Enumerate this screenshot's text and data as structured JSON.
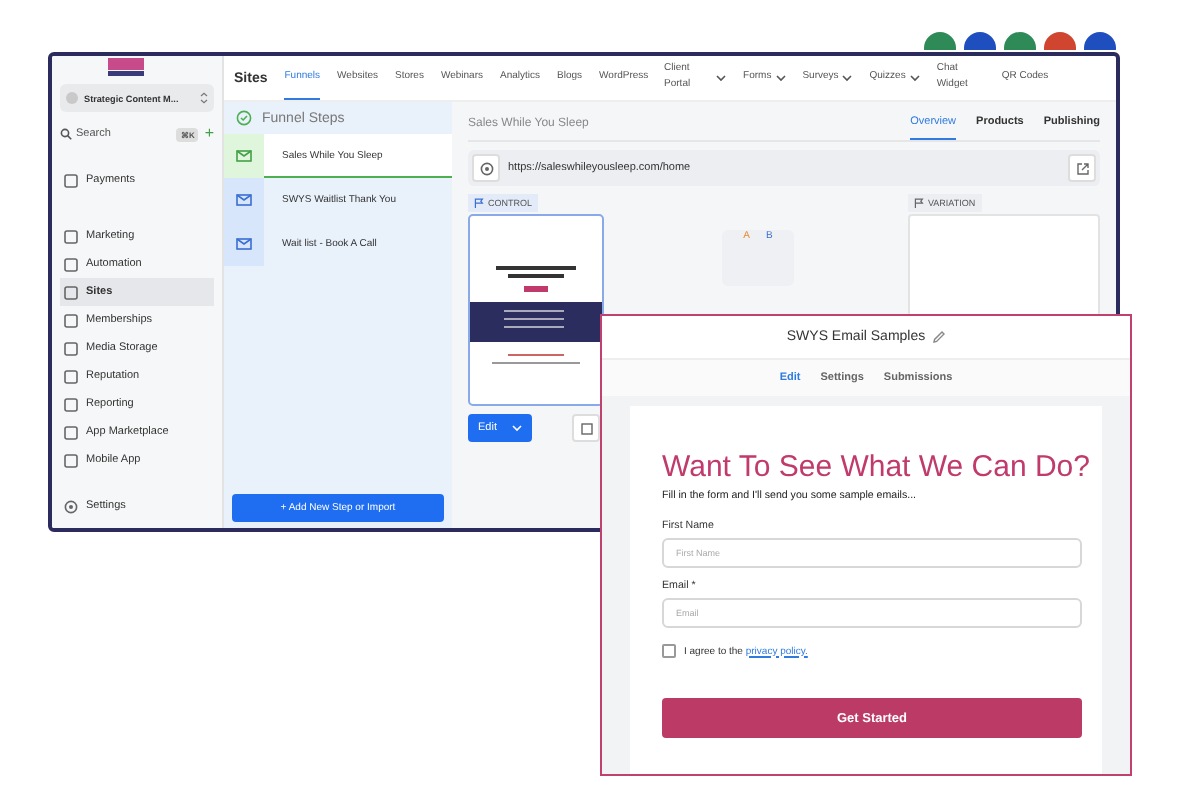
{
  "sidebar": {
    "account": "Strategic Content M...",
    "search": {
      "placeholder": "Search",
      "shortcut": "⌘K",
      "add": "+"
    },
    "items": [
      {
        "label": "Payments",
        "selected": false
      },
      {
        "label": "Marketing",
        "selected": false
      },
      {
        "label": "Automation",
        "selected": false
      },
      {
        "label": "Sites",
        "selected": true
      },
      {
        "label": "Memberships",
        "selected": false
      },
      {
        "label": "Media Storage",
        "selected": false
      },
      {
        "label": "Reputation",
        "selected": false
      },
      {
        "label": "Reporting",
        "selected": false
      },
      {
        "label": "App Marketplace",
        "selected": false
      },
      {
        "label": "Mobile App",
        "selected": false
      }
    ],
    "settings": "Settings"
  },
  "topbar": {
    "section": "Sites",
    "tabs": [
      {
        "label": "Funnels",
        "selected": true,
        "dropdown": false
      },
      {
        "label": "Websites",
        "selected": false,
        "dropdown": false
      },
      {
        "label": "Stores",
        "selected": false,
        "dropdown": false
      },
      {
        "label": "Webinars",
        "selected": false,
        "dropdown": false
      },
      {
        "label": "Analytics",
        "selected": false,
        "dropdown": false
      },
      {
        "label": "Blogs",
        "selected": false,
        "dropdown": false
      },
      {
        "label": "WordPress",
        "selected": false,
        "dropdown": false
      },
      {
        "label": "Client Portal",
        "selected": false,
        "dropdown": true
      },
      {
        "label": "Forms",
        "selected": false,
        "dropdown": true
      },
      {
        "label": "Surveys",
        "selected": false,
        "dropdown": true
      },
      {
        "label": "Quizzes",
        "selected": false,
        "dropdown": true
      },
      {
        "label": "Chat Widget",
        "selected": false,
        "dropdown": false
      },
      {
        "label": "QR Codes",
        "selected": false,
        "dropdown": false
      }
    ]
  },
  "funnel_steps": {
    "title": "Funnel Steps",
    "steps": [
      {
        "name": "Sales While You Sleep",
        "selected": true
      },
      {
        "name": "SWYS Waitlist Thank You",
        "selected": false
      },
      {
        "name": "Wait list - Book A Call",
        "selected": false
      }
    ],
    "add_button": "+ Add New Step or Import"
  },
  "page": {
    "title": "Sales While You Sleep",
    "tabs": [
      {
        "label": "Overview",
        "selected": true
      },
      {
        "label": "Products",
        "selected": false
      },
      {
        "label": "Publishing",
        "selected": false
      }
    ],
    "url": "https://saleswhileyousleep.com/home",
    "control_label": "CONTROL",
    "variation_label": "VARIATION",
    "edit_button": "Edit",
    "ab_labels": [
      "A",
      "B"
    ]
  },
  "form_window": {
    "title": "SWYS Email Samples",
    "tabs": [
      {
        "label": "Edit",
        "selected": true
      },
      {
        "label": "Settings",
        "selected": false
      },
      {
        "label": "Submissions",
        "selected": false
      }
    ],
    "heading": "Want To See What We Can Do?",
    "intro": "Fill in the form and I'll send you some sample emails...",
    "fields": [
      {
        "label": "First Name",
        "placeholder": "First Name"
      },
      {
        "label": "Email *",
        "placeholder": "Email"
      }
    ],
    "consent": {
      "text": "I agree to the",
      "link": "privacy policy.",
      "checked": false
    },
    "submit": "Get Started"
  }
}
